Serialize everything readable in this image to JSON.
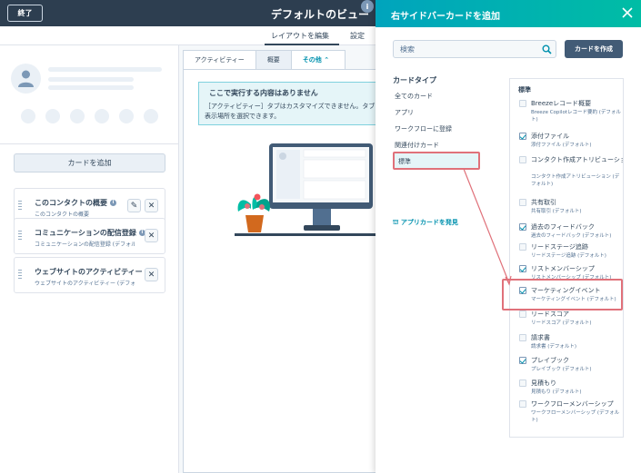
{
  "topbar": {
    "close_label": "終了",
    "title": "デフォルトのビュー",
    "avatar_initial": "i"
  },
  "subnav": {
    "layout_tab": "レイアウトを編集",
    "settings_tab": "設定"
  },
  "left": {
    "add_card_label": "カードを追加",
    "cards": [
      {
        "title": "このコンタクトの概要",
        "subtitle": "このコンタクトの概要"
      },
      {
        "title": "コミュニケーションの配信登録",
        "subtitle": "コミュニケーションの配信登録 (デフォル..."
      },
      {
        "title": "ウェブサイトのアクティビティー",
        "subtitle": "ウェブサイトのアクティビティー (デフォ..."
      }
    ]
  },
  "center": {
    "tabs": [
      "アクティビティー",
      "概要",
      "その他"
    ],
    "notice_title": "ここで実行する内容はありません",
    "notice_body_1": "［アクティビティー］タブはカスタマイズできません。タブを",
    "notice_body_2": "表示場所を選択できます。"
  },
  "panel": {
    "title": "右サイドバーカードを追加",
    "search_placeholder": "検索",
    "create_label": "カードを作成",
    "category_title": "カードタイプ",
    "categories": [
      "全てのカード",
      "アプリ",
      "ワークフローに登録",
      "関連付けカード",
      "標準"
    ],
    "app_link": "アプリカードを発見",
    "list_header": "標準",
    "items": [
      {
        "name": "Breezeレコード概要",
        "desc": "Breeze Copilotレコード要約 (デフォルト)",
        "checked": false
      },
      {
        "name": "添付ファイル",
        "desc": "添付ファイル (デフォルト)",
        "checked": true
      },
      {
        "name": "コンタクト作成アトリビューション",
        "desc": "コンタクト作成アトリビューション (デフォルト)",
        "checked": false
      },
      {
        "name": "共有取引",
        "desc": "共有取引 (デフォルト)",
        "checked": false
      },
      {
        "name": "過去のフィードバック",
        "desc": "過去のフィードバック (デフォルト)",
        "checked": true
      },
      {
        "name": "リードステージ追跡",
        "desc": "リードステージ追跡 (デフォルト)",
        "checked": false
      },
      {
        "name": "リストメンバーシップ",
        "desc": "リストメンバーシップ (デフォルト)",
        "checked": true
      },
      {
        "name": "マーケティングイベント",
        "desc": "マーケティングイベント (デフォルト)",
        "checked": true
      },
      {
        "name": "リードスコア",
        "desc": "リードスコア (デフォルト)",
        "checked": false
      },
      {
        "name": "請求書",
        "desc": "請求書 (デフォルト)",
        "checked": false
      },
      {
        "name": "プレイブック",
        "desc": "プレイブック (デフォルト)",
        "checked": true
      },
      {
        "name": "見積もり",
        "desc": "見積もり (デフォルト)",
        "checked": false
      },
      {
        "name": "ワークフローメンバーシップ",
        "desc": "ワークフローメンバーシップ (デフォルト)",
        "checked": false
      }
    ]
  },
  "colors": {
    "topbar": "#2d3e50",
    "accent": "#00a4bd",
    "highlight": "#e0717a"
  }
}
